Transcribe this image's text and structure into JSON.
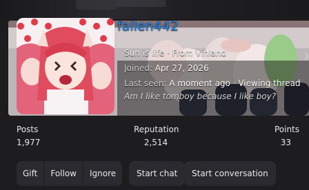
{
  "profile": {
    "username": "fallen442",
    "tagline_parts": [
      "Sun is life",
      "From Vinland"
    ],
    "joined_label": "Joined:",
    "joined_value": "Apr 27, 2026",
    "last_seen_label": "Last seen:",
    "last_seen_value": "A moment ago",
    "last_seen_activity": "Viewing thread",
    "custom_title": "Am I like tomboy because I like boy?"
  },
  "stats": {
    "posts_label": "Posts",
    "posts_value": "1,977",
    "reputation_label": "Reputation",
    "reputation_value": "2,514",
    "points_label": "Points",
    "points_value": "33"
  },
  "actions": {
    "gift": "Gift",
    "follow": "Follow",
    "ignore": "Ignore",
    "start_chat": "Start chat",
    "start_conversation": "Start conversation"
  },
  "colors": {
    "username": "#1e86e8",
    "background": "#1d1d20",
    "button_bg": "#2b2b2f"
  }
}
